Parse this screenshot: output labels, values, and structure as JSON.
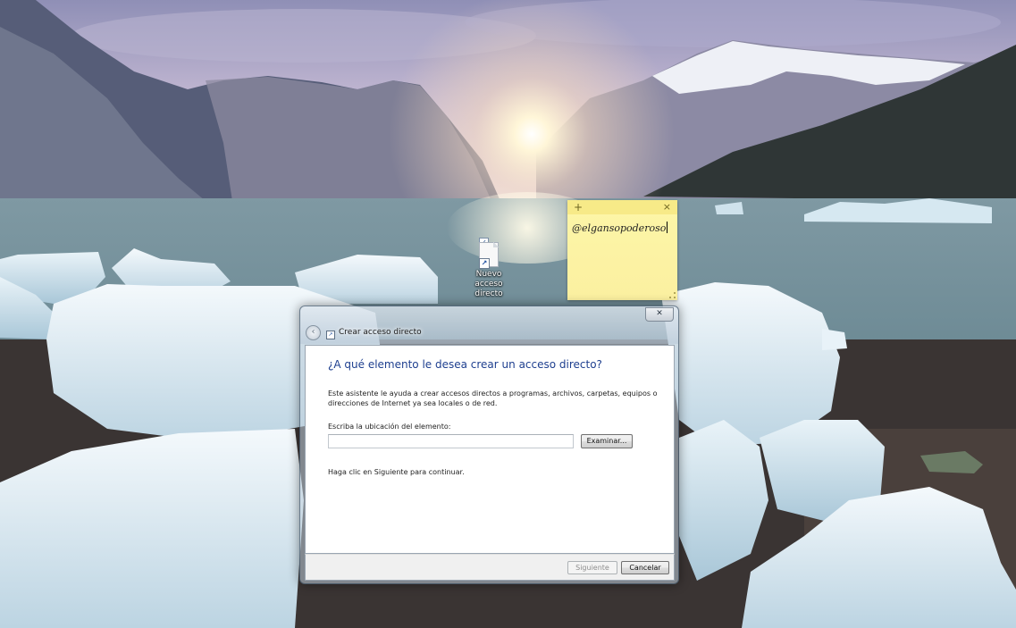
{
  "desktop": {
    "shortcut": {
      "label": "Nuevo acceso directo",
      "icon": "shortcut-file-icon"
    }
  },
  "sticky_note": {
    "text": "@elgansopoderoso",
    "add_symbol": "+",
    "close_symbol": "×"
  },
  "wizard": {
    "title": "Crear acceso directo",
    "close_symbol": "✕",
    "back_symbol": "‹",
    "heading": "¿A qué elemento le desea crear un acceso directo?",
    "description": "Este asistente le ayuda a crear accesos directos a programas, archivos, carpetas, equipos o direcciones de Internet ya sea locales o de red.",
    "location_label": "Escriba la ubicación del elemento:",
    "location_value": "",
    "browse_button": "Examinar...",
    "continue_text": "Haga clic en Siguiente para continuar.",
    "next_button": "Siguiente",
    "next_enabled": false,
    "cancel_button": "Cancelar"
  },
  "colors": {
    "heading_blue": "#1e3f8f",
    "sticky_yellow": "#fdf6a8"
  }
}
